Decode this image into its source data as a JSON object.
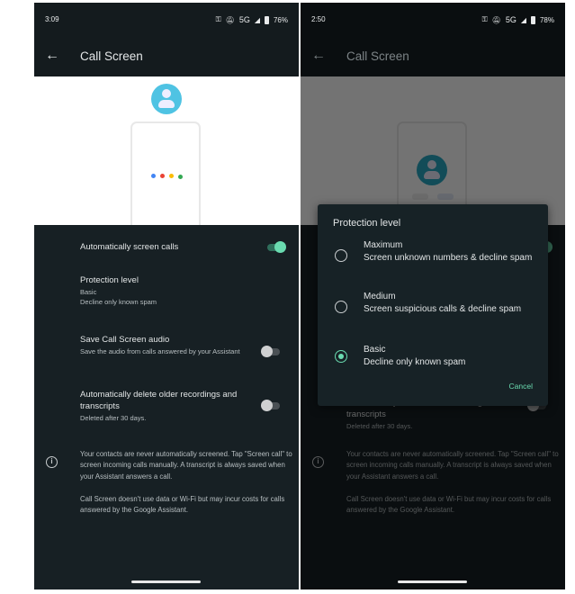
{
  "left": {
    "status": {
      "time": "3:09",
      "network": "5G",
      "battery": "76%"
    },
    "title": "Call Screen"
  },
  "right": {
    "status": {
      "time": "2:50",
      "network": "5G",
      "battery": "78%"
    },
    "title": "Call Screen"
  },
  "settings": {
    "auto_screen": {
      "label": "Automatically screen calls",
      "enabled": true
    },
    "protection": {
      "label": "Protection level",
      "value": "Basic",
      "desc": "Decline only known spam"
    },
    "save_audio": {
      "label": "Save Call Screen audio",
      "desc": "Save the audio from calls answered by your Assistant",
      "enabled": false
    },
    "auto_delete": {
      "label": "Automatically delete older recordings and transcripts",
      "desc": "Deleted after 30 days.",
      "enabled": false
    }
  },
  "info": {
    "p1": "Your contacts are never automatically screened. Tap \"Screen call\" to screen incoming calls manually. A transcript is always saved when your Assistant answers a call.",
    "p2": "Call Screen doesn't use data or Wi-Fi but may incur costs for calls answered by the Google Assistant."
  },
  "dialog": {
    "title": "Protection level",
    "options": [
      {
        "name": "Maximum",
        "desc": "Screen unknown numbers & decline spam",
        "selected": false
      },
      {
        "name": "Medium",
        "desc": "Screen suspicious calls & decline spam",
        "selected": false
      },
      {
        "name": "Basic",
        "desc": "Decline only known spam",
        "selected": true
      }
    ],
    "cancel": "Cancel"
  },
  "colors": {
    "accent": "#6adbb0",
    "background": "#172024",
    "avatar": "#4fc3e3"
  },
  "icons": {
    "back": "arrow-left-icon",
    "status": [
      "vpn-key-icon",
      "bell-off-icon",
      "signal-icon",
      "battery-icon"
    ],
    "info": "info-icon"
  }
}
